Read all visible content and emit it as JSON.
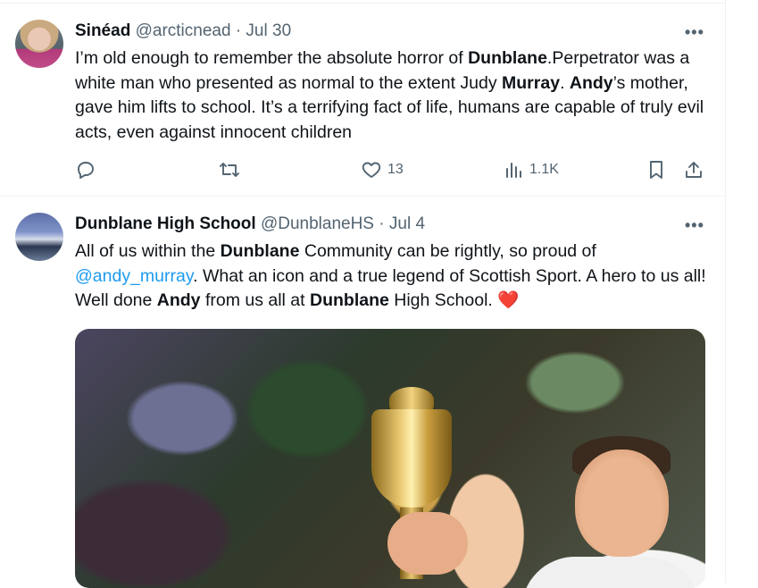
{
  "tweets": [
    {
      "name": "Sinéad",
      "handle": "@arcticnead",
      "date": "· Jul 30",
      "more": "•••",
      "text_parts": [
        "I’m old enough to remember the absolute horror of ",
        "Dunblane",
        ".Perpetrator was a white man who presented as normal to the extent Judy ",
        "Murray",
        ". ",
        "Andy",
        "’s mother, gave him lifts to school. It’s a terrifying fact of life, humans are capable of truly evil acts, even against innocent children"
      ],
      "actions": {
        "reply_icon": "reply-icon",
        "retweet_icon": "retweet-icon",
        "like_icon": "heart-icon",
        "likes": "13",
        "views_icon": "views-icon",
        "views": "1.1K",
        "bookmark_icon": "bookmark-icon",
        "share_icon": "share-icon"
      }
    },
    {
      "name": "Dunblane High School",
      "handle": "@DunblaneHS",
      "date": "· Jul 4",
      "more": "•••",
      "text_parts": [
        "All of us within the ",
        "Dunblane",
        " Community can be rightly, so proud of ",
        "@andy_murray",
        ". What an icon and a true legend of Scottish Sport. A hero to us all! Well done ",
        "Andy",
        " from us all at ",
        "Dunblane",
        " High School. ",
        "❤️"
      ],
      "media_icon": "photo-trophy"
    }
  ],
  "colors": {
    "text": "#0f1419",
    "muted": "#536471",
    "link": "#1d9bf0",
    "heart": "#e0245e"
  }
}
